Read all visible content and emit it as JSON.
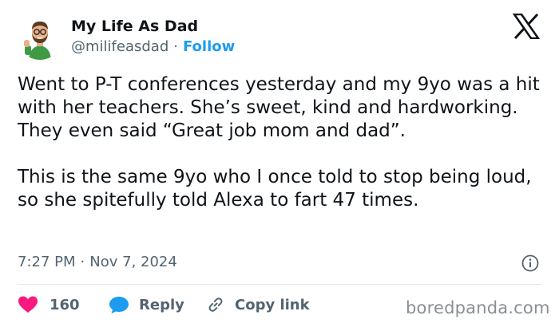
{
  "author": {
    "name": "My Life As Dad",
    "handle": "@milifeasdad",
    "separator": "·",
    "follow_label": "Follow"
  },
  "tweet": {
    "paragraphs": [
      "Went to P-T conferences yesterday and my 9yo was a hit with her teachers. She’s sweet, kind and hardworking. They even said “Great job mom and dad”.",
      "This is the same 9yo who I once told to stop being loud, so she spitefully told Alexa to fart 47 times."
    ],
    "time": "7:27 PM",
    "date": "Nov 7, 2024",
    "separator": "·"
  },
  "actions": {
    "likes_count": "160",
    "reply_label": "Reply",
    "copy_link_label": "Copy link"
  },
  "watermark": "boredpanda.com",
  "icons": {
    "avatar": "cartoon-dad-avatar",
    "logo": "x-logo-icon",
    "info": "info-icon",
    "like": "heart-icon",
    "reply": "speech-bubble-icon",
    "copy": "link-icon"
  },
  "colors": {
    "like": "#f91880",
    "reply": "#1d9bf0",
    "follow": "#1d9bf0",
    "muted_text": "#536471",
    "text": "#0f1419"
  }
}
